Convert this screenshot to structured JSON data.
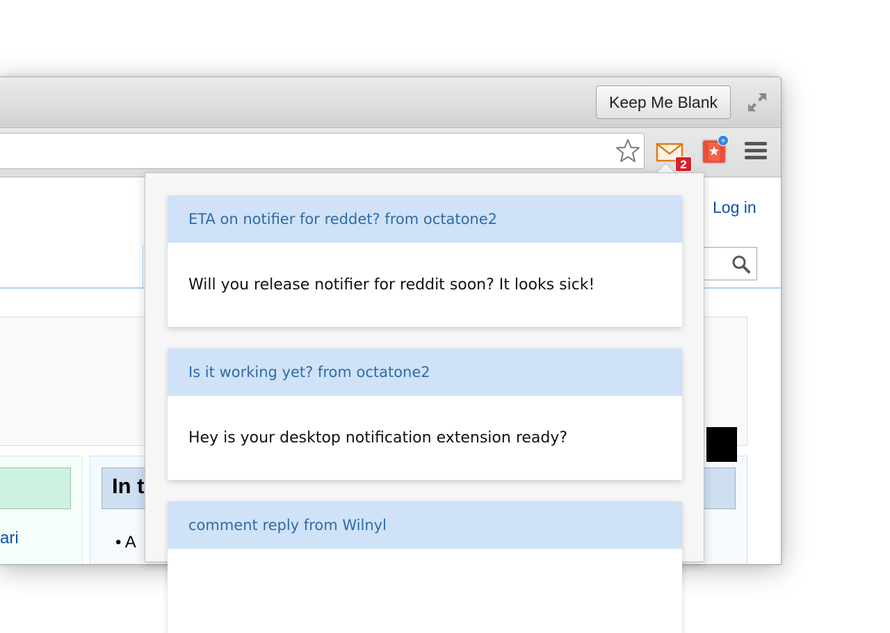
{
  "titlebar": {
    "keep_blank_label": "Keep Me Blank"
  },
  "toolbar": {
    "mail_badge_count": "2"
  },
  "page": {
    "login_label": "Log in",
    "partial_header": "In t",
    "partial_link": "ari",
    "partial_bullet": "A"
  },
  "notifications": [
    {
      "title": "ETA on notifier for reddet? from octatone2",
      "body": "Will you release notifier for reddit soon? It looks sick!"
    },
    {
      "title": "Is it working yet? from octatone2",
      "body": "Hey is your desktop notification extension ready?"
    },
    {
      "title": "comment reply from Wilnyl",
      "body": ""
    }
  ],
  "colors": {
    "card_header_bg": "#cfe2f7",
    "card_header_text": "#2f6aa6",
    "badge": "#d6222a",
    "mail_icon": "#e07b1a"
  },
  "icons": [
    "fullscreen-icon",
    "star-icon",
    "mail-icon",
    "bookmark-star-icon",
    "menu-icon",
    "search-icon"
  ]
}
